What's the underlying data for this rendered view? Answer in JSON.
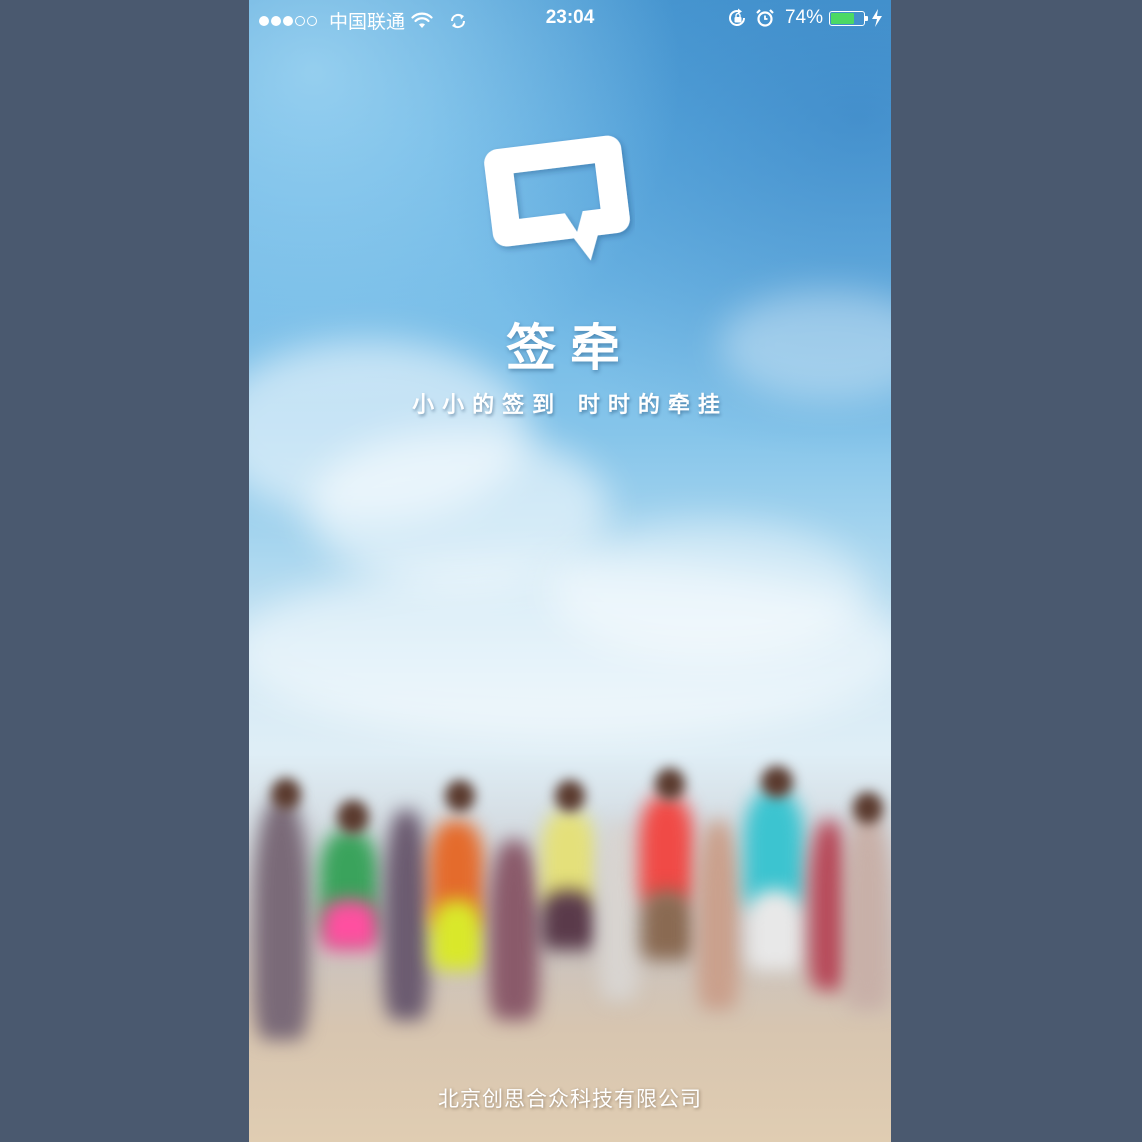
{
  "status_bar": {
    "signal_dots": [
      "filled",
      "filled",
      "filled",
      "empty",
      "empty"
    ],
    "carrier": "中国联通",
    "wifi_icon": "wifi-icon",
    "sync_icon": "sync-icon",
    "time": "23:04",
    "rotation_lock_icon": "rotation-lock-icon",
    "alarm_icon": "alarm-icon",
    "battery_percent_text": "74%",
    "battery_level": 0.74,
    "battery_color": "#4cd964",
    "charging_icon": "lightning-icon"
  },
  "splash": {
    "logo_icon": "speech-bubble-logo-icon",
    "app_name": "签牵",
    "slogan": "小小的签到 时时的牵挂",
    "company": "北京创思合众科技有限公司"
  },
  "colors": {
    "page_background": "#4a596f",
    "sky_top": "#4d9ed6",
    "text": "#ffffff"
  }
}
